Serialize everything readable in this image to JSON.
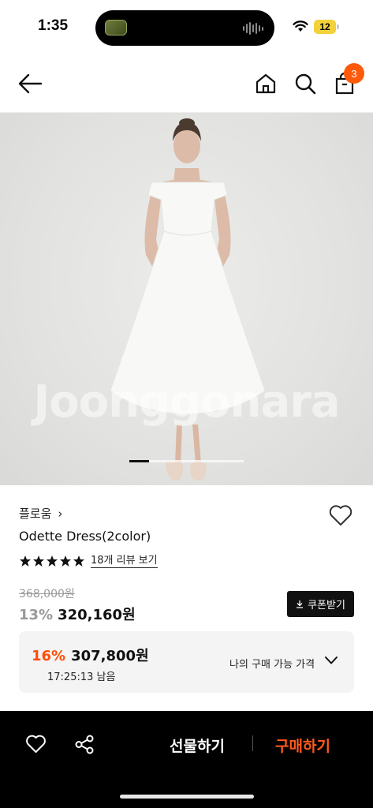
{
  "status_bar": {
    "time": "1:35",
    "battery": "12"
  },
  "nav": {
    "cart_count": "3",
    "icons": [
      "back-arrow-icon",
      "home-icon",
      "search-icon",
      "shopping-bag-icon"
    ]
  },
  "image": {
    "watermark": "Joonggonara",
    "slide_index": 1
  },
  "product": {
    "brand": "플로움",
    "brand_chevron": "›",
    "name": "Odette Dress(2color)",
    "rating_stars": 5,
    "review_link": "18개 리뷰 보기",
    "original_price": "368,000원",
    "discount_rate": "13%",
    "price": "320,160원",
    "coupon_button": "쿠폰받기"
  },
  "best_price": {
    "discount_rate": "16%",
    "price": "307,800원",
    "timer": "17:25:13 남음",
    "label": "나의 구매 가능 가격"
  },
  "bottom_bar": {
    "gift_label": "선물하기",
    "buy_label": "구매하기"
  },
  "colors": {
    "accent": "#ff5a0a",
    "buy": "#ff5a1a",
    "bar_bg": "#000000"
  }
}
